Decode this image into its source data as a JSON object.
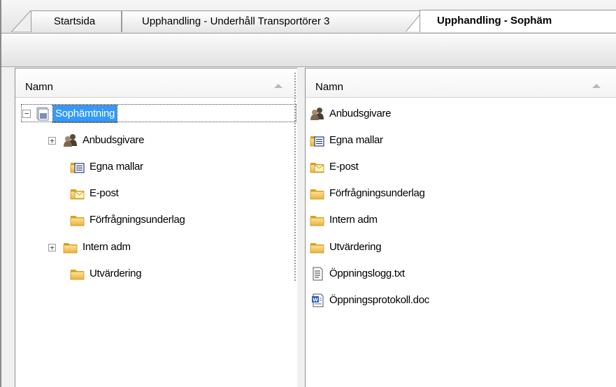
{
  "tabs": [
    {
      "label": "Startsida",
      "active": false
    },
    {
      "label": "Upphandling - Underhåll Transportörer 3",
      "active": false
    },
    {
      "label": "Upphandling - Sophäm",
      "active": true
    }
  ],
  "left_panel": {
    "column_header": "Namn",
    "tree": {
      "root": {
        "label": "Sophämtning",
        "icon": "document-stack-icon",
        "expanded": true,
        "expander": "−"
      },
      "children": [
        {
          "label": "Anbudsgivare",
          "icon": "users-icon",
          "expander": "+"
        },
        {
          "label": "Egna mallar",
          "icon": "template-folder-icon"
        },
        {
          "label": "E-post",
          "icon": "mail-folder-icon"
        },
        {
          "label": "Förfrågningsunderlag",
          "icon": "folder-icon"
        },
        {
          "label": "Intern adm",
          "icon": "folder-icon",
          "expander": "+"
        },
        {
          "label": "Utvärdering",
          "icon": "folder-icon"
        }
      ]
    }
  },
  "right_panel": {
    "column_header": "Namn",
    "items": [
      {
        "label": "Anbudsgivare",
        "icon": "users-icon"
      },
      {
        "label": "Egna mallar",
        "icon": "template-folder-icon"
      },
      {
        "label": "E-post",
        "icon": "mail-folder-icon"
      },
      {
        "label": "Förfrågningsunderlag",
        "icon": "folder-icon"
      },
      {
        "label": "Intern adm",
        "icon": "folder-icon"
      },
      {
        "label": "Utvärdering",
        "icon": "folder-icon"
      },
      {
        "label": "Öppningslogg.txt",
        "icon": "text-file-icon"
      },
      {
        "label": "Öppningsprotokoll.doc",
        "icon": "word-doc-icon"
      }
    ]
  },
  "colors": {
    "selection": "#3399ff",
    "folder": "#f2c24f",
    "folder_dark": "#d9a21e"
  }
}
